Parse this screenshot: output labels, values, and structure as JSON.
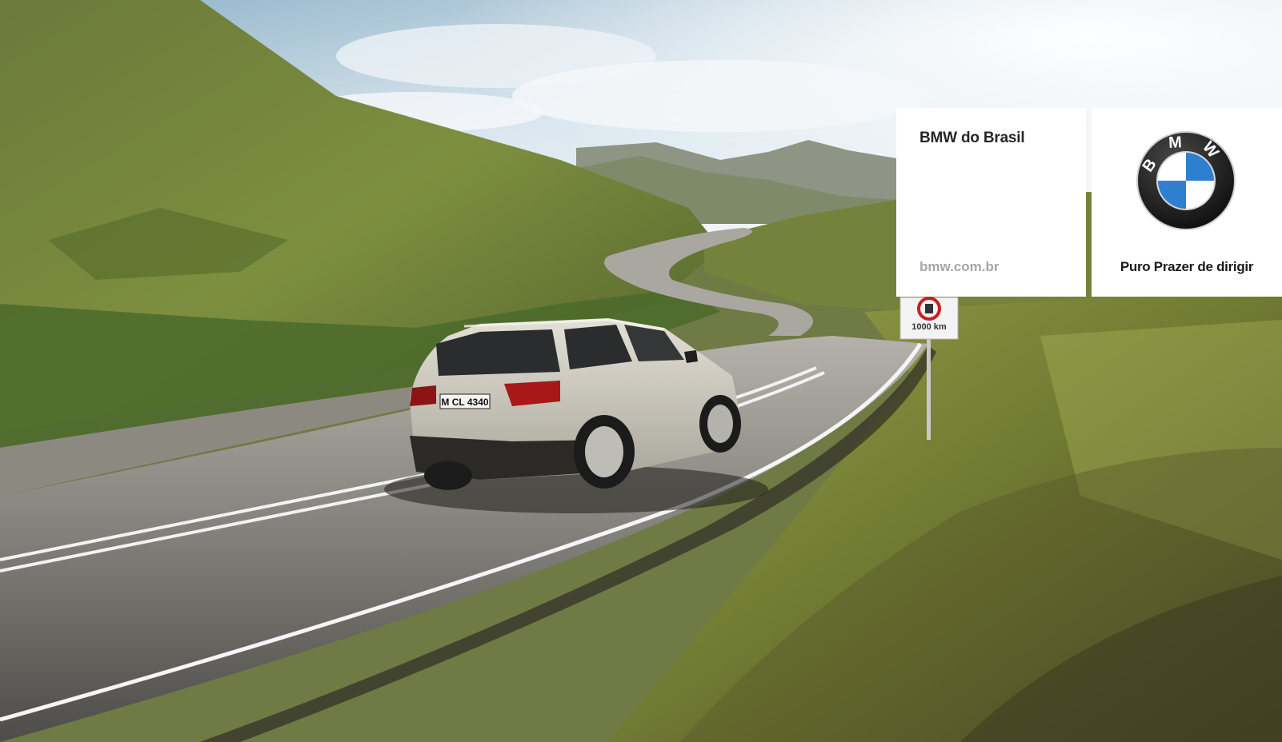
{
  "ad": {
    "brand_name": "BMW do Brasil",
    "website": "bmw.com.br",
    "tagline": "Puro Prazer de dirigir",
    "logo_letters": [
      "B",
      "M",
      "W"
    ]
  },
  "scene": {
    "license_plate": "M CL 4340",
    "road_sign_distance": "1000 km"
  },
  "colors": {
    "bmw_blue": "#2f7fd1",
    "logo_ring": "#111111",
    "panel_background": "#ffffff"
  }
}
